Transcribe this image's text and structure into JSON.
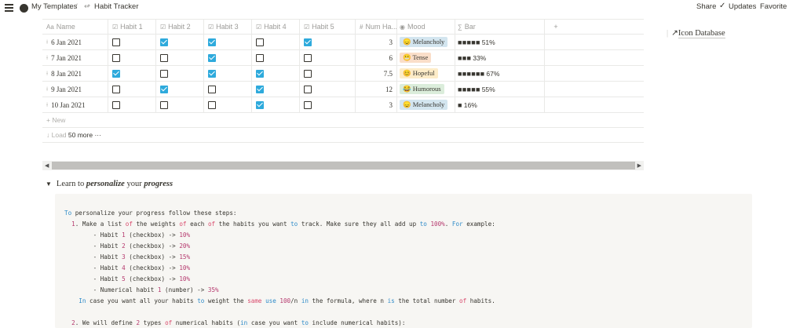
{
  "topbar": {
    "breadcrumb": [
      {
        "label": "My Templates"
      },
      {
        "label": "Habit Tracker",
        "icon": "↫"
      }
    ],
    "separator": "/",
    "share": "Share",
    "updates": "Updates",
    "favorite": "Favorite"
  },
  "table": {
    "columns": {
      "name": {
        "label": "Name",
        "icon": "Aa"
      },
      "habit1": {
        "label": "Habit 1"
      },
      "habit2": {
        "label": "Habit 2"
      },
      "habit3": {
        "label": "Habit 3"
      },
      "habit4": {
        "label": "Habit 4"
      },
      "habit5": {
        "label": "Habit 5"
      },
      "num": {
        "label": "Num Ha...",
        "icon": "#"
      },
      "mood": {
        "label": "Mood"
      },
      "bar": {
        "label": "Bar",
        "icon": "∑"
      },
      "add": {
        "label": "+"
      }
    },
    "rows": [
      {
        "name": "6 Jan 2021",
        "icon": "⟊",
        "habits": [
          false,
          true,
          true,
          false,
          true
        ],
        "num": "3",
        "mood": "😞 Melancholy",
        "mood_color": "#d3e5ef",
        "bar": "■■■■■",
        "bar_pct": "51%"
      },
      {
        "name": "7 Jan 2021",
        "icon": "⟊",
        "habits": [
          false,
          false,
          true,
          false,
          false
        ],
        "num": "6",
        "mood": "😬 Tense",
        "mood_color": "#fadec9",
        "bar": "■■■",
        "bar_pct": "33%"
      },
      {
        "name": "8 Jan 2021",
        "icon": "⟊",
        "habits": [
          true,
          false,
          true,
          true,
          false
        ],
        "num": "7.5",
        "mood": "😊 Hopeful",
        "mood_color": "#fdecc8",
        "bar": "■■■■■■",
        "bar_pct": "67%"
      },
      {
        "name": "9 Jan 2021",
        "icon": "⟊",
        "habits": [
          false,
          true,
          false,
          true,
          false
        ],
        "num": "12",
        "mood": "😂 Humorous",
        "mood_color": "#dbeddb",
        "bar": "■■■■■",
        "bar_pct": "55%"
      },
      {
        "name": "10 Jan 2021",
        "icon": "⟊",
        "habits": [
          false,
          false,
          false,
          true,
          false
        ],
        "num": "3",
        "mood": "😞 Melancholy",
        "mood_color": "#d3e5ef",
        "bar": "■",
        "bar_pct": "16%"
      }
    ],
    "new_label": "+ New",
    "load_prefix": "↓ Load",
    "load_count": "50 more",
    "load_dots": "···"
  },
  "side_link": {
    "label": "Icon Database",
    "arrow": "↗"
  },
  "toggle": {
    "part1": "Learn to ",
    "part2": "personalize",
    "part3": " your ",
    "part4": "progress"
  },
  "code_lines": [
    "To personalize your progress follow these steps:",
    "  1. Make a list of the weights of each of the habits you want to track. Make sure they all add up to 100%. For example:",
    "        - Habit 1 (checkbox) -> 10%",
    "        - Habit 2 (checkbox) -> 20%",
    "        - Habit 3 (checkbox) -> 15%",
    "        - Habit 4 (checkbox) -> 10%",
    "        - Habit 5 (checkbox) -> 10%",
    "        - Numerical habit 1 (number) -> 35%",
    "    In case you want all your habits to weight the same use 100/n in the formula, where n is the total number of habits.",
    "",
    "  2. We will define 2 types of numerical habits (in case you want to include numerical habits):"
  ]
}
